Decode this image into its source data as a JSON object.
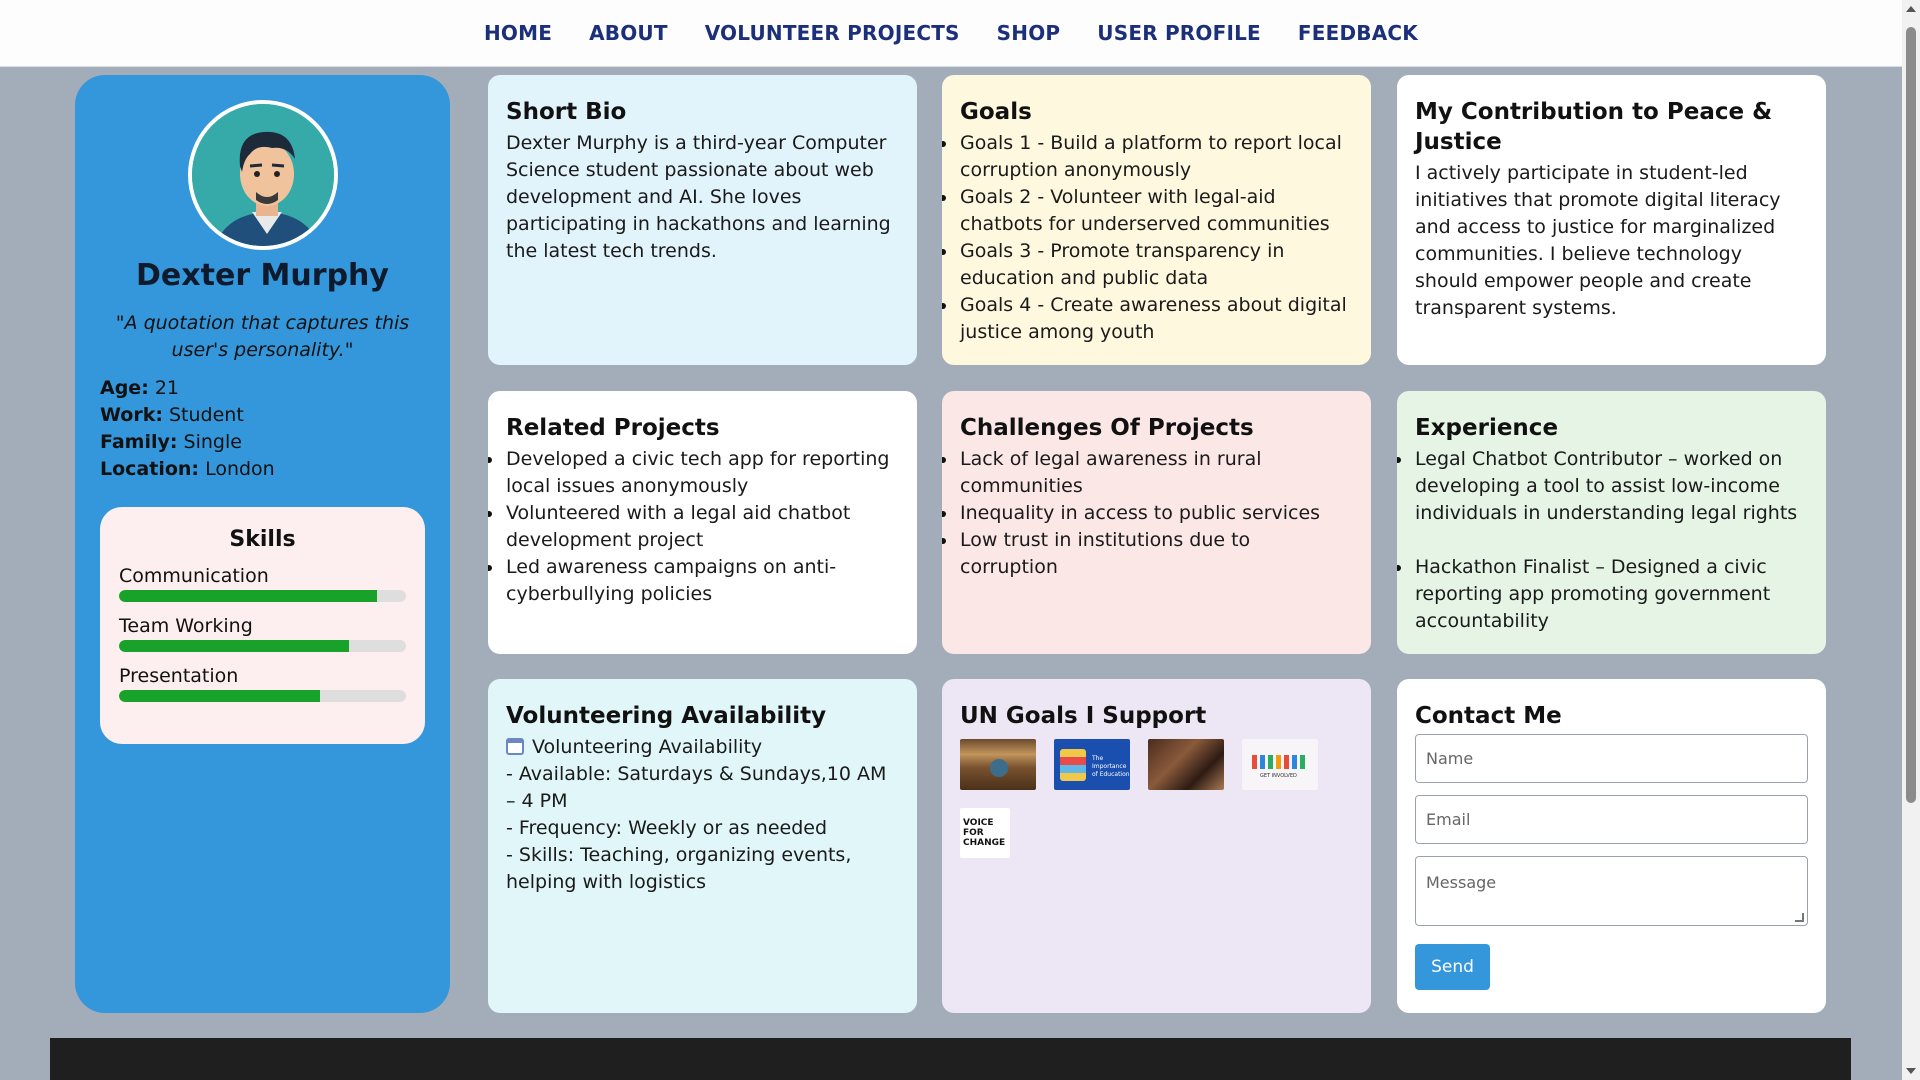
{
  "nav": [
    "HOME",
    "ABOUT",
    "VOLUNTEER PROJECTS",
    "SHOP",
    "USER PROFILE",
    "FEEDBACK"
  ],
  "profile": {
    "name": "Dexter Murphy",
    "quote": "\"A quotation that captures this user's personality.\"",
    "age_label": "Age:",
    "age": " 21",
    "work_label": "Work:",
    "work": " Student",
    "family_label": "Family:",
    "family": " Single",
    "location_label": "Location:",
    "location": " London"
  },
  "skills": {
    "title": "Skills",
    "items": [
      {
        "name": "Communication",
        "level": 0.9
      },
      {
        "name": "Team Working",
        "level": 0.8
      },
      {
        "name": "Presentation",
        "level": 0.7
      }
    ]
  },
  "short_bio": {
    "title": "Short Bio",
    "text": "Dexter Murphy is a third-year Computer Science student passionate about web development and AI. She loves participating in hackathons and learning the latest tech trends."
  },
  "goals": {
    "title": "Goals",
    "items": [
      "Goals 1 - Build a platform to report local corruption anonymously",
      "Goals 2 - Volunteer with legal-aid chatbots for underserved communities",
      "Goals 3 - Promote transparency in education and public data",
      "Goals 4 - Create awareness about digital justice among youth"
    ]
  },
  "contribution": {
    "title": "My Contribution to Peace & Justice",
    "text": "I actively participate in student-led initiatives that promote digital literacy and access to justice for marginalized communities. I believe technology should empower people and create transparent systems."
  },
  "related_projects": {
    "title": "Related Projects",
    "items": [
      "Developed a civic tech app for reporting local issues anonymously",
      "Volunteered with a legal aid chatbot development project",
      "Led awareness campaigns on anti-cyberbullying policies"
    ]
  },
  "challenges": {
    "title": "Challenges Of Projects",
    "items": [
      "Lack of legal awareness in rural communities",
      "Inequality in access to public services",
      "Low trust in institutions due to corruption"
    ]
  },
  "experience": {
    "title": "Experience",
    "items": [
      "Legal Chatbot Contributor – worked on developing a tool to assist low-income individuals in understanding legal rights",
      "Hackathon Finalist – Designed a civic reporting app promoting government accountability"
    ]
  },
  "availability": {
    "title": "Volunteering Availability",
    "subtitle": "Volunteering Availability",
    "lines": [
      "- Available: Saturdays & Sundays,10 AM – 4 PM",
      "- Frequency: Weekly or as needed",
      "- Skills: Teaching, organizing events, helping with logistics"
    ]
  },
  "un_goals": {
    "title": "UN Goals I Support",
    "images": [
      {
        "icon": "library-books-image"
      },
      {
        "icon": "importance-of-education-image",
        "caption": "The Importance of Education"
      },
      {
        "icon": "group-hands-image"
      },
      {
        "icon": "get-involved-image",
        "caption": "GET INVOLVED"
      },
      {
        "icon": "voice-for-change-image",
        "caption": "VOICE FOR CHANGE"
      }
    ]
  },
  "contact": {
    "title": "Contact Me",
    "name_placeholder": "Name",
    "email_placeholder": "Email",
    "message_placeholder": "Message",
    "send_label": "Send"
  },
  "colors": {
    "profile_bg": "#3497db",
    "page_bg": "#a3adb9",
    "nav_text": "#1c2f7a",
    "skill_fill": "#19a22a"
  }
}
